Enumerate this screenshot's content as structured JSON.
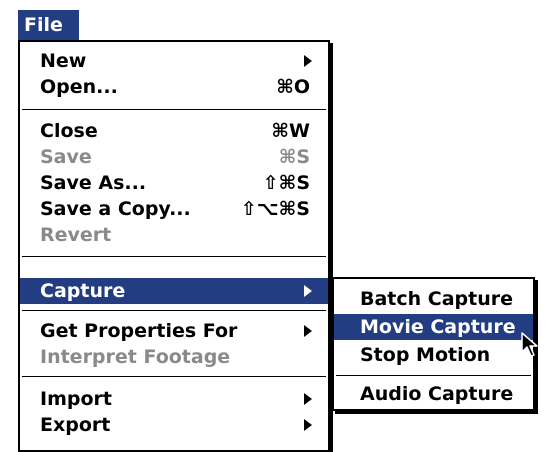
{
  "menubar": {
    "title": "File"
  },
  "file_menu": {
    "items": [
      {
        "label": "New",
        "shortcut": "",
        "submenu": true,
        "enabled": true
      },
      {
        "label": "Open...",
        "shortcut": "⌘O",
        "submenu": false,
        "enabled": true
      },
      {
        "label": "Close",
        "shortcut": "⌘W",
        "submenu": false,
        "enabled": true
      },
      {
        "label": "Save",
        "shortcut": "⌘S",
        "submenu": false,
        "enabled": false
      },
      {
        "label": "Save As...",
        "shortcut": "⇧⌘S",
        "submenu": false,
        "enabled": true
      },
      {
        "label": "Save a Copy...",
        "shortcut": "⇧⌥⌘S",
        "submenu": false,
        "enabled": true
      },
      {
        "label": "Revert",
        "shortcut": "",
        "submenu": false,
        "enabled": false
      },
      {
        "label": "Capture",
        "shortcut": "",
        "submenu": true,
        "enabled": true,
        "highlighted": true
      },
      {
        "label": "Get Properties For",
        "shortcut": "",
        "submenu": true,
        "enabled": true
      },
      {
        "label": "Interpret Footage",
        "shortcut": "",
        "submenu": false,
        "enabled": false
      },
      {
        "label": "Import",
        "shortcut": "",
        "submenu": true,
        "enabled": true
      },
      {
        "label": "Export",
        "shortcut": "",
        "submenu": true,
        "enabled": true
      }
    ]
  },
  "capture_submenu": {
    "items": [
      {
        "label": "Batch Capture",
        "enabled": true
      },
      {
        "label": "Movie Capture",
        "enabled": true,
        "highlighted": true
      },
      {
        "label": "Stop Motion",
        "enabled": true
      },
      {
        "label": "Audio Capture",
        "enabled": true
      }
    ]
  },
  "colors": {
    "highlight": "#223d82",
    "disabled": "#8a8a8a"
  },
  "icons": {
    "cursor": "arrow-cursor-icon",
    "submenu_arrow": "triangle-right-icon"
  }
}
